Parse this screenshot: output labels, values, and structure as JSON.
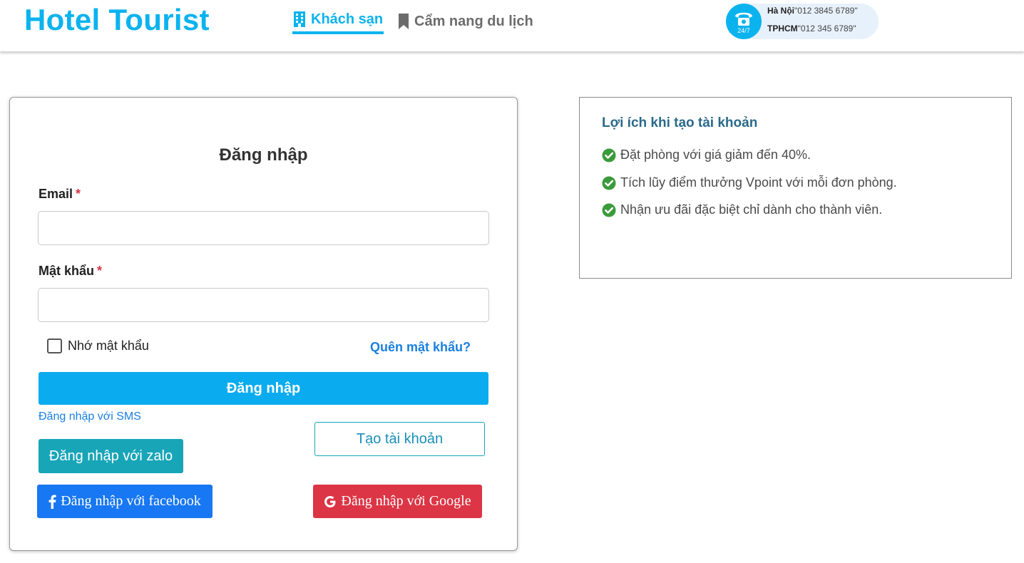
{
  "header": {
    "logo": "Hotel Tourist",
    "nav": [
      {
        "label": "Khách sạn",
        "icon": "building-icon",
        "active": true
      },
      {
        "label": "Cẩm nang du lịch",
        "icon": "bookmark-icon",
        "active": false
      }
    ],
    "contact": {
      "hours": "24/7",
      "line1_city": "Hà Nội",
      "line1_phone": "\"012 3845 6789\"",
      "line2_city": "TPHCM",
      "line2_phone": "\"012 345 6789\""
    }
  },
  "login": {
    "title": "Đăng nhập",
    "email_label": "Email",
    "password_label": "Mật khẩu",
    "required_mark": "*",
    "email_value": "",
    "password_value": "",
    "remember_label": "Nhớ mật khẩu",
    "forgot_label": "Quên mật khẩu?",
    "submit_label": "Đăng nhập",
    "sms_label": "Đăng nhập với SMS",
    "zalo_label": "Đăng nhập với zalo",
    "create_label": "Tạo tài khoản",
    "facebook_label": "Đăng nhập với facebook",
    "google_label": "Đăng nhập với Google"
  },
  "benefits": {
    "title": "Lợi ích khi tạo tài khoản",
    "items": [
      "Đặt phòng với giá giảm đến 40%.",
      "Tích lũy điểm thưởng Vpoint với mỗi đơn phòng.",
      "Nhận ưu đãi đặc biệt chỉ dành cho thành viên."
    ]
  },
  "colors": {
    "brand": "#0bb3ee",
    "facebook": "#1877f2",
    "google": "#dc3545",
    "zalo": "#18a5b8",
    "check": "#3b9a3b"
  }
}
